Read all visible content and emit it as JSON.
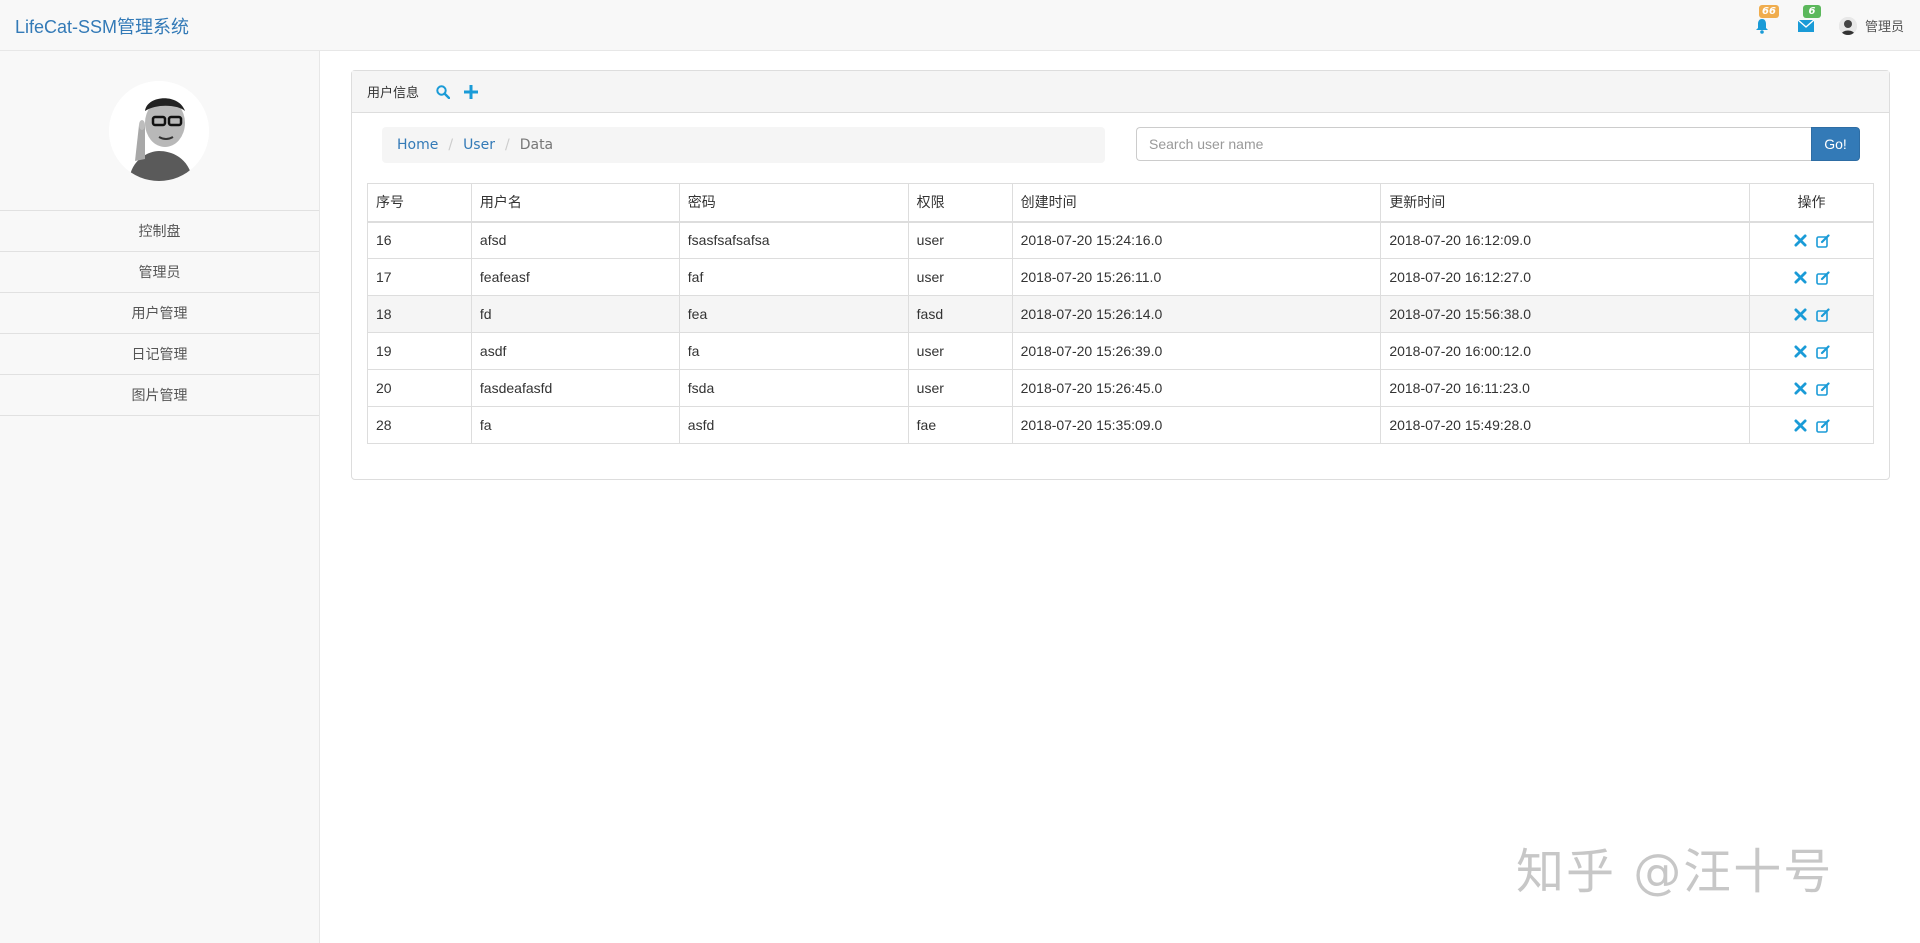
{
  "app": {
    "brand": "LifeCat-SSM管理系统"
  },
  "navbar": {
    "notifications_count": "66",
    "messages_count": "6",
    "user_name": "管理员"
  },
  "sidebar": {
    "items": [
      {
        "label": "控制盘"
      },
      {
        "label": "管理员"
      },
      {
        "label": "用户管理"
      },
      {
        "label": "日记管理"
      },
      {
        "label": "图片管理"
      }
    ]
  },
  "panel": {
    "title": "用户信息"
  },
  "breadcrumb": {
    "items": [
      "Home",
      "User",
      "Data"
    ]
  },
  "search": {
    "placeholder": "Search user name",
    "value": "",
    "button_label": "Go!"
  },
  "table": {
    "columns": [
      "序号",
      "用户名",
      "密码",
      "权限",
      "创建时间",
      "更新时间",
      "操作"
    ],
    "rows": [
      [
        "16",
        "afsd",
        "fsasfsafsafsa",
        "user",
        "2018-07-20 15:24:16.0",
        "2018-07-20 16:12:09.0"
      ],
      [
        "17",
        "feafeasf",
        "faf",
        "user",
        "2018-07-20 15:26:11.0",
        "2018-07-20 16:12:27.0"
      ],
      [
        "18",
        "fd",
        "fea",
        "fasd",
        "2018-07-20 15:26:14.0",
        "2018-07-20 15:56:38.0"
      ],
      [
        "19",
        "asdf",
        "fa",
        "user",
        "2018-07-20 15:26:39.0",
        "2018-07-20 16:00:12.0"
      ],
      [
        "20",
        "fasdeafasfd",
        "fsda",
        "user",
        "2018-07-20 15:26:45.0",
        "2018-07-20 16:11:23.0"
      ],
      [
        "28",
        "fa",
        "asfd",
        "fae",
        "2018-07-20 15:35:09.0",
        "2018-07-20 15:49:28.0"
      ]
    ]
  },
  "watermark": "知乎 @汪十号",
  "colors": {
    "accent": "#337ab7",
    "icon_blue": "#1a9bd7",
    "badge_warning": "#f0ad4e",
    "badge_success": "#5cb85c"
  }
}
